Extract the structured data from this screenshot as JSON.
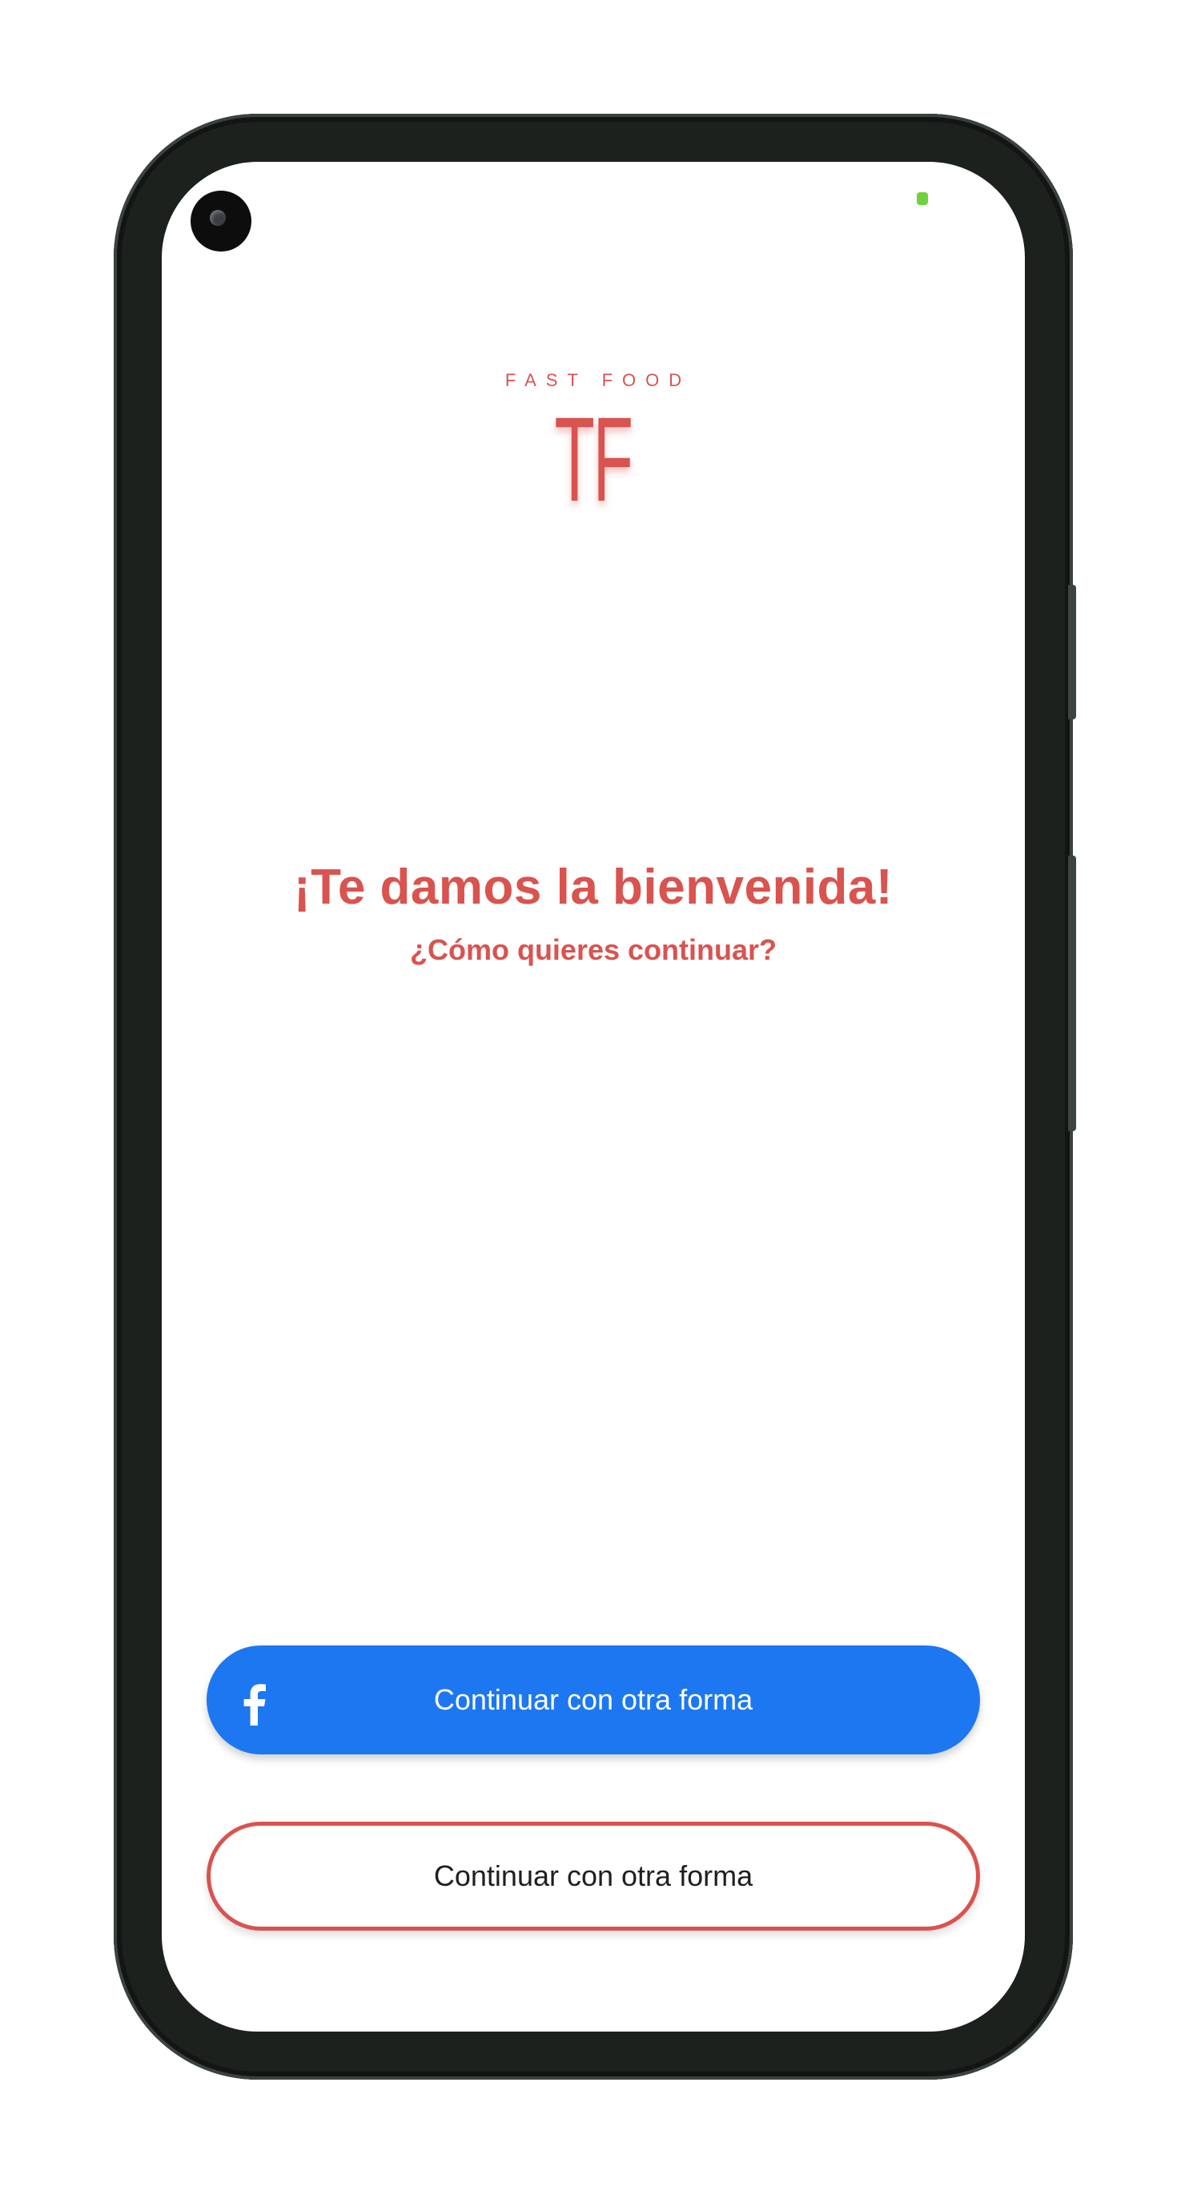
{
  "logo": {
    "tagline": "FAST FOOD",
    "mark": "TF"
  },
  "welcome": {
    "title": "¡Te damos la bienvenida!",
    "subtitle": "¿Cómo quieres continuar?"
  },
  "buttons": {
    "facebook_label": "Continuar con otra forma",
    "facebook_icon": "facebook-icon",
    "other_label": "Continuar con otra forma"
  },
  "colors": {
    "brand_red": "#d9534f",
    "facebook_blue": "#1d77f0",
    "background": "#ffffff"
  }
}
